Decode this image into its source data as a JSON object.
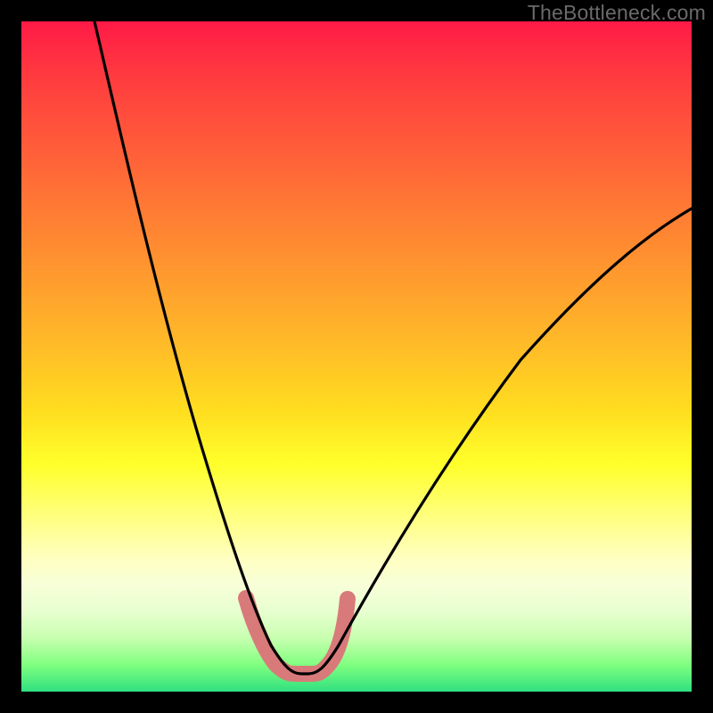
{
  "watermark": "TheBottleneck.com",
  "chart_data": {
    "type": "line",
    "title": "",
    "xlabel": "",
    "ylabel": "",
    "xlim": [
      0,
      100
    ],
    "ylim": [
      0,
      100
    ],
    "gradient_stops": [
      {
        "pos": 0,
        "color": "#ff1a47"
      },
      {
        "pos": 8,
        "color": "#ff3a3f"
      },
      {
        "pos": 18,
        "color": "#ff5a3a"
      },
      {
        "pos": 28,
        "color": "#ff7a34"
      },
      {
        "pos": 38,
        "color": "#ff9a2e"
      },
      {
        "pos": 48,
        "color": "#ffba28"
      },
      {
        "pos": 58,
        "color": "#ffdd20"
      },
      {
        "pos": 66,
        "color": "#ffff2a"
      },
      {
        "pos": 74,
        "color": "#ffff80"
      },
      {
        "pos": 80,
        "color": "#ffffc0"
      },
      {
        "pos": 84,
        "color": "#f8ffd8"
      },
      {
        "pos": 88,
        "color": "#e8ffd0"
      },
      {
        "pos": 92,
        "color": "#c8ffb0"
      },
      {
        "pos": 96,
        "color": "#80ff80"
      },
      {
        "pos": 100,
        "color": "#30e080"
      }
    ],
    "series": [
      {
        "name": "bottleneck-curve",
        "stroke": "#000000",
        "x": [
          11,
          15,
          20,
          25,
          30,
          34,
          36,
          38,
          40,
          44,
          46,
          48,
          50,
          55,
          60,
          68,
          78,
          90,
          100
        ],
        "y": [
          100,
          88,
          74,
          58,
          41,
          24,
          14,
          8,
          4,
          4,
          6,
          10,
          15,
          26,
          36,
          48,
          58,
          66,
          72
        ]
      },
      {
        "name": "bottleneck-highlight",
        "stroke": "#d97a7a",
        "stroke_width": 12,
        "x": [
          33.5,
          35,
          37,
          38,
          40,
          42,
          44,
          45,
          47,
          48.5
        ],
        "y": [
          14,
          9,
          5,
          3.5,
          3,
          3,
          3.5,
          5,
          9,
          14
        ]
      }
    ],
    "annotations": []
  }
}
